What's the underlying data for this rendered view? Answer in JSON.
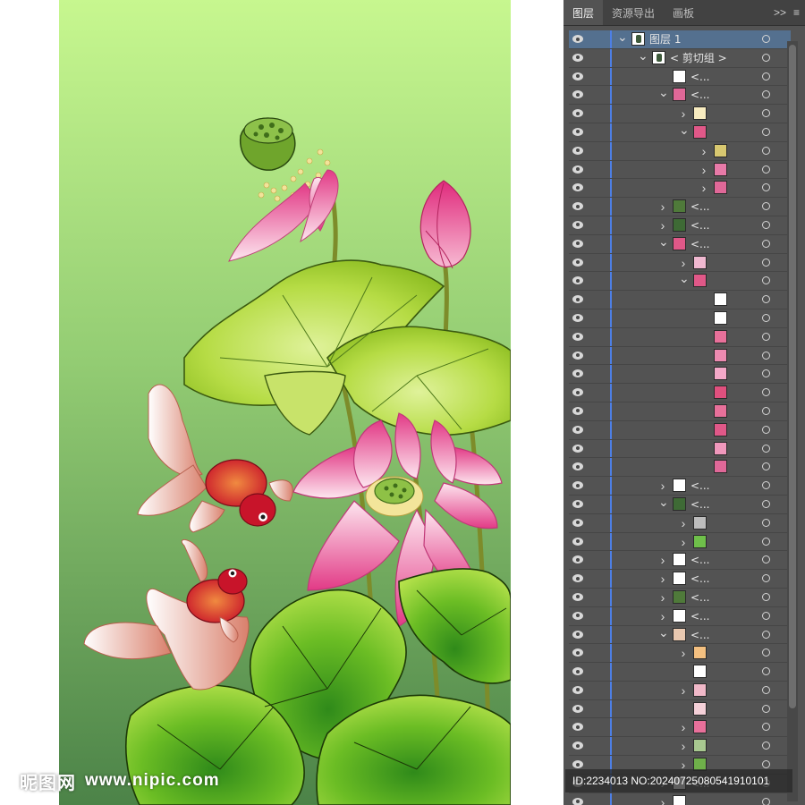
{
  "panel": {
    "tabs": [
      "图层",
      "资源导出",
      "画板"
    ],
    "expand_label": ">>",
    "menu_label": "≡"
  },
  "layers": [
    {
      "depth": 0,
      "chevron": "down",
      "thumb": "dark",
      "name": "图层 1",
      "selected": true
    },
    {
      "depth": 1,
      "chevron": "down",
      "thumb": "dark",
      "name": "< 剪切组 >"
    },
    {
      "depth": 2,
      "chevron": "",
      "thumb": "#ffffff",
      "name": "<..."
    },
    {
      "depth": 2,
      "chevron": "down",
      "thumb": "#e06898",
      "name": "<..."
    },
    {
      "depth": 3,
      "chevron": "right",
      "thumb": "#f8ecc0"
    },
    {
      "depth": 3,
      "chevron": "down",
      "thumb": "#e05888"
    },
    {
      "depth": 4,
      "chevron": "right",
      "thumb": "#d8c870"
    },
    {
      "depth": 4,
      "chevron": "right",
      "thumb": "#e87aa8"
    },
    {
      "depth": 4,
      "chevron": "right",
      "thumb": "#e06898"
    },
    {
      "depth": 2,
      "chevron": "right",
      "thumb": "#4f7a3a",
      "name": "<..."
    },
    {
      "depth": 2,
      "chevron": "right",
      "thumb": "#3e6a35",
      "name": "<..."
    },
    {
      "depth": 2,
      "chevron": "down",
      "thumb": "#e05888",
      "name": "<..."
    },
    {
      "depth": 3,
      "chevron": "right",
      "thumb": "#f0b8d0"
    },
    {
      "depth": 3,
      "chevron": "down",
      "thumb": "#e05888"
    },
    {
      "depth": 4,
      "chevron": "",
      "thumb": "#ffffff"
    },
    {
      "depth": 4,
      "chevron": "",
      "thumb": "#ffffff"
    },
    {
      "depth": 4,
      "chevron": "",
      "thumb": "#e8709a"
    },
    {
      "depth": 4,
      "chevron": "",
      "thumb": "#ec8ab0"
    },
    {
      "depth": 4,
      "chevron": "",
      "thumb": "#f4a8c8"
    },
    {
      "depth": 4,
      "chevron": "",
      "thumb": "#e0507e"
    },
    {
      "depth": 4,
      "chevron": "",
      "thumb": "#e8709a"
    },
    {
      "depth": 4,
      "chevron": "",
      "thumb": "#e05888"
    },
    {
      "depth": 4,
      "chevron": "",
      "thumb": "#f098bc"
    },
    {
      "depth": 4,
      "chevron": "",
      "thumb": "#e06898"
    },
    {
      "depth": 2,
      "chevron": "right",
      "thumb": "#ffffff",
      "name": "<..."
    },
    {
      "depth": 2,
      "chevron": "down",
      "thumb": "#3e6a35",
      "name": "<..."
    },
    {
      "depth": 3,
      "chevron": "right",
      "thumb": "#bdbdbd"
    },
    {
      "depth": 3,
      "chevron": "right",
      "thumb": "#6fc04a"
    },
    {
      "depth": 2,
      "chevron": "right",
      "thumb": "#ffffff",
      "name": "<..."
    },
    {
      "depth": 2,
      "chevron": "right",
      "thumb": "#ffffff",
      "name": "<..."
    },
    {
      "depth": 2,
      "chevron": "right",
      "thumb": "#4f7a3a",
      "name": "<..."
    },
    {
      "depth": 2,
      "chevron": "right",
      "thumb": "#ffffff",
      "name": "<..."
    },
    {
      "depth": 2,
      "chevron": "down",
      "thumb": "#e8c8b0",
      "name": "<..."
    },
    {
      "depth": 3,
      "chevron": "right",
      "thumb": "#f4c080"
    },
    {
      "depth": 3,
      "chevron": "",
      "thumb": "#ffffff"
    },
    {
      "depth": 3,
      "chevron": "right",
      "thumb": "#f0b8c8"
    },
    {
      "depth": 3,
      "chevron": "",
      "thumb": "#f4d0d8"
    },
    {
      "depth": 3,
      "chevron": "right",
      "thumb": "#e8709a"
    },
    {
      "depth": 3,
      "chevron": "right",
      "thumb": "#a8c890"
    },
    {
      "depth": 3,
      "chevron": "right",
      "thumb": "#6fb04a"
    },
    {
      "depth": 2,
      "chevron": "right",
      "thumb": "#ffffff",
      "name": "<..."
    },
    {
      "depth": 2,
      "chevron": "right",
      "thumb": "#ffffff"
    }
  ],
  "status": {
    "id_text": "ID:2234013 NO:20240725080541910101"
  },
  "watermark": {
    "cn": "昵图网",
    "url": "www.nipic.com"
  },
  "colors": {
    "bg_top": "#c7f78f",
    "bg_bottom": "#5f9a57",
    "lotus_pink": "#e8488a",
    "leaf_green": "#6bbd24",
    "fish_red": "#c8142a"
  }
}
